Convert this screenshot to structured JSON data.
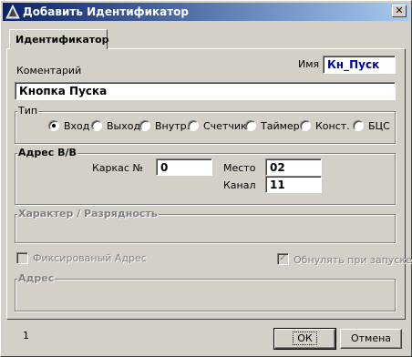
{
  "window": {
    "title": "Добавить Идентификатор",
    "close_label": "✕"
  },
  "tab": {
    "label": "Идентификатор"
  },
  "name": {
    "label": "Имя",
    "value": "Кн_Пуск"
  },
  "comment": {
    "label": "Коментарий",
    "value": "Кнопка Пуска"
  },
  "type_group": {
    "label": "Тип",
    "options": [
      "Вход",
      "Выход",
      "Внутр.",
      "Счетчик",
      "Таймер",
      "Конст.",
      "БЦС"
    ],
    "selected": "Вход"
  },
  "address_io": {
    "label": "Адрес В/В",
    "frame_label": "Каркас №",
    "frame_value": "0",
    "place_label": "Место",
    "place_value": "02",
    "channel_label": "Канал",
    "channel_value": "11"
  },
  "character_group": {
    "label": "Характер / Разрядность"
  },
  "fixed_address": {
    "label": "Фиксированый Адрес",
    "checked": false
  },
  "reset_on_start": {
    "label": "Обнулять при запуске",
    "checked": true
  },
  "address_group": {
    "label": "Адрес"
  },
  "footer": {
    "status_number": "1",
    "ok_label": "ОК",
    "cancel_label": "Отмена"
  }
}
